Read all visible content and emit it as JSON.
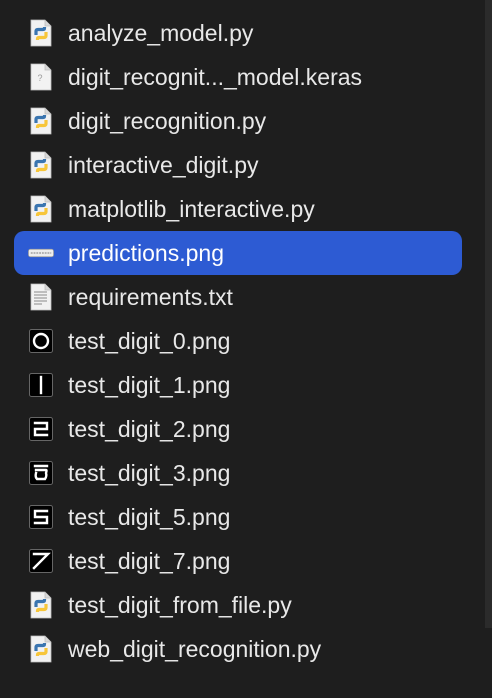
{
  "files": [
    {
      "name": "analyze_model.py",
      "icon": "python-file-icon",
      "selected": false
    },
    {
      "name": "digit_recognit..._model.keras",
      "icon": "unknown-file-icon",
      "selected": false
    },
    {
      "name": "digit_recognition.py",
      "icon": "python-file-icon",
      "selected": false
    },
    {
      "name": "interactive_digit.py",
      "icon": "python-file-icon",
      "selected": false
    },
    {
      "name": "matplotlib_interactive.py",
      "icon": "python-file-icon",
      "selected": false
    },
    {
      "name": "predictions.png",
      "icon": "image-strip-thumbnail-icon",
      "selected": true
    },
    {
      "name": "requirements.txt",
      "icon": "text-file-icon",
      "selected": false
    },
    {
      "name": "test_digit_0.png",
      "icon": "digit-0-thumbnail-icon",
      "selected": false
    },
    {
      "name": "test_digit_1.png",
      "icon": "digit-1-thumbnail-icon",
      "selected": false
    },
    {
      "name": "test_digit_2.png",
      "icon": "digit-2-thumbnail-icon",
      "selected": false
    },
    {
      "name": "test_digit_3.png",
      "icon": "digit-3-thumbnail-icon",
      "selected": false
    },
    {
      "name": "test_digit_5.png",
      "icon": "digit-5-thumbnail-icon",
      "selected": false
    },
    {
      "name": "test_digit_7.png",
      "icon": "digit-7-thumbnail-icon",
      "selected": false
    },
    {
      "name": "test_digit_from_file.py",
      "icon": "python-file-icon",
      "selected": false
    },
    {
      "name": "web_digit_recognition.py",
      "icon": "python-file-icon",
      "selected": false
    }
  ],
  "colors": {
    "background": "#1e1e1e",
    "selection": "#2d5bd3",
    "text": "#e8e8e8",
    "python_blue": "#3a75b0",
    "python_yellow": "#f7c63a"
  }
}
